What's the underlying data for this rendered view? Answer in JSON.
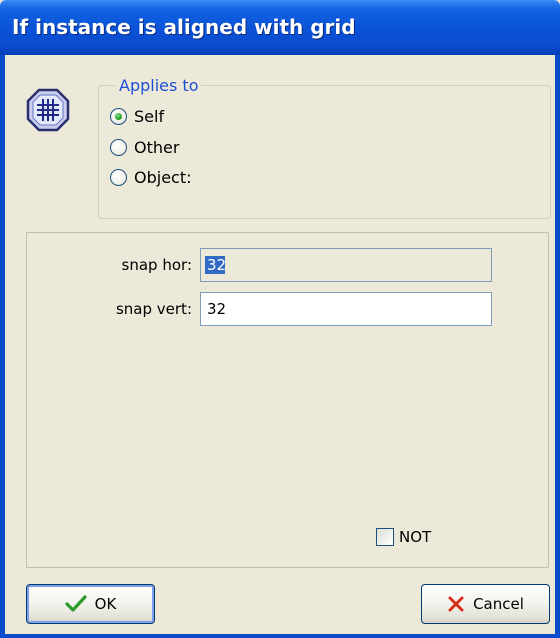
{
  "window": {
    "title": "If instance is aligned with grid"
  },
  "icons": {
    "action": "grid-icon"
  },
  "applies_to": {
    "legend": "Applies to",
    "options": [
      {
        "label": "Self",
        "checked": true
      },
      {
        "label": "Other",
        "checked": false
      },
      {
        "label": "Object:",
        "checked": false
      }
    ]
  },
  "fields": {
    "snap_hor": {
      "label": "snap hor:",
      "value": "32"
    },
    "snap_vert": {
      "label": "snap vert:",
      "value": "32"
    }
  },
  "not_checkbox": {
    "label": "NOT",
    "checked": false
  },
  "buttons": {
    "ok": "OK",
    "cancel": "Cancel"
  },
  "colors": {
    "title_bar": "#0a52d8",
    "legend": "#1c4fd6",
    "ok_check": "#2a9a2a",
    "cancel_x": "#d6301c"
  }
}
